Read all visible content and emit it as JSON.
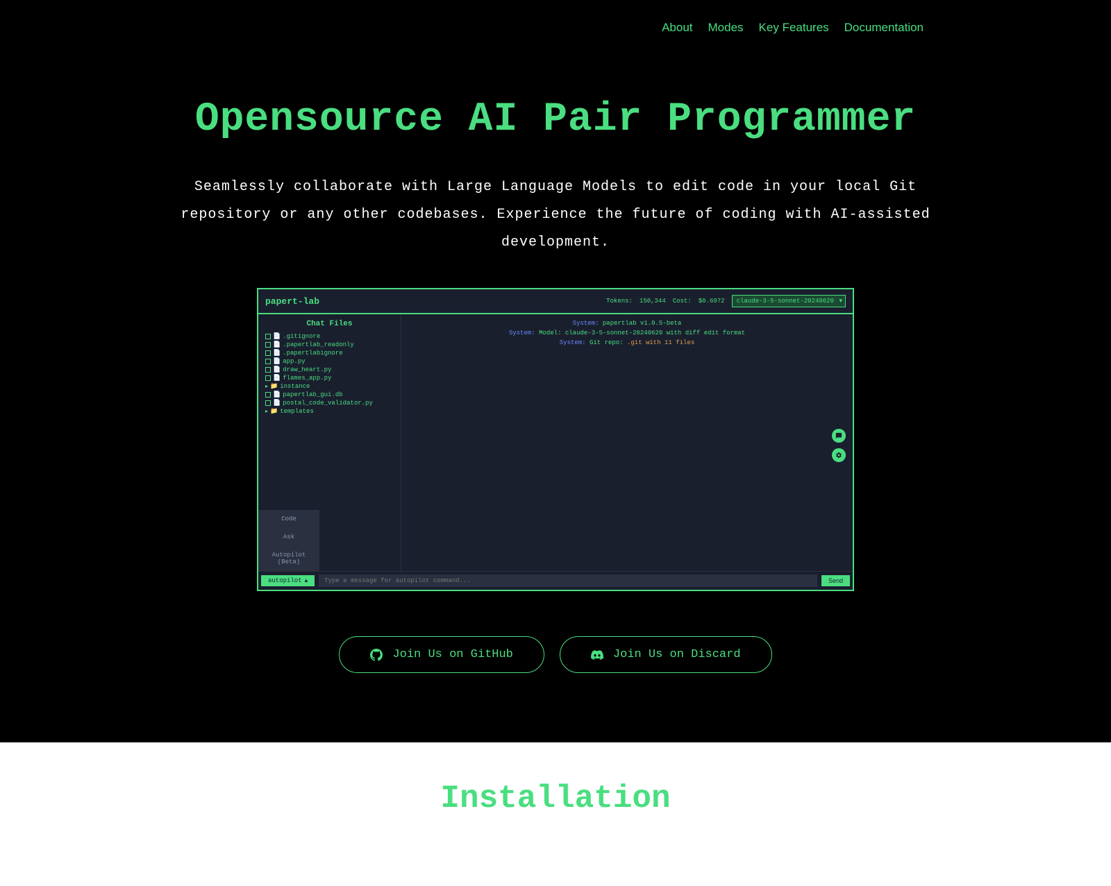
{
  "nav": {
    "about": "About",
    "modes": "Modes",
    "features": "Key Features",
    "docs": "Documentation"
  },
  "hero": {
    "title": "Opensource AI Pair Programmer",
    "subtitle": "Seamlessly collaborate with Large Language Models to edit code in your local Git repository or any other codebases. Experience the future of coding with AI-assisted development."
  },
  "app": {
    "title": "papert-lab",
    "tokens_label": "Tokens:",
    "tokens_value": "150,344",
    "cost_label": "Cost:",
    "cost_value": "$0.6972",
    "model": "claude-3-5-sonnet-20240620",
    "sidebar_title": "Chat Files",
    "files": [
      {
        "name": ".gitignore",
        "type": "file"
      },
      {
        "name": ".papertlab_readonly",
        "type": "file"
      },
      {
        "name": ".papertlabignore",
        "type": "file"
      },
      {
        "name": "app.py",
        "type": "file"
      },
      {
        "name": "draw_heart.py",
        "type": "file"
      },
      {
        "name": "flames_app.py",
        "type": "file"
      },
      {
        "name": "instance",
        "type": "folder"
      },
      {
        "name": "papertlab_gui.db",
        "type": "file"
      },
      {
        "name": "postal_code_validator.py",
        "type": "file"
      },
      {
        "name": "templates",
        "type": "folder"
      }
    ],
    "modes": {
      "code": "Code",
      "ask": "Ask",
      "autopilot": "Autopilot (Beta)"
    },
    "sys1_label": "System:",
    "sys1_text": "papertlab v1.0.5-beta",
    "sys2_label": "System:",
    "sys2_text_a": "Model: claude-3-5-sonnet-20240620 with ",
    "sys2_text_b": "diff",
    "sys2_text_c": " edit format",
    "sys3_label": "System:",
    "sys3_text_a": "Git repo: ",
    "sys3_text_b": ".git with 11 files",
    "mode_current": "autopilot",
    "input_placeholder": "Type a message for autopilot command...",
    "send": "Send"
  },
  "cta": {
    "github": "Join Us on GitHub",
    "discord": "Join Us on Discard"
  },
  "install": {
    "title": "Installation"
  }
}
